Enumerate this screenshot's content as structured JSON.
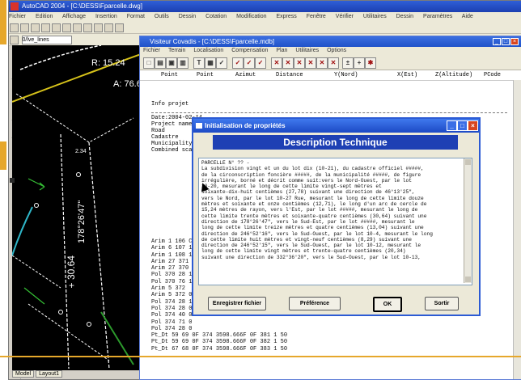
{
  "autocad": {
    "title": "AutoCAD 2004 - [C:\\DESS\\Fparcelle.dwg]",
    "menu": [
      "Fichier",
      "Edition",
      "Affichage",
      "Insertion",
      "Format",
      "Outils",
      "Dessin",
      "Cotation",
      "Modification",
      "Express",
      "Fenêtre",
      "Vérifier",
      "Utilitaires",
      "Dessin",
      "Paramètres",
      "Aide"
    ],
    "layer_field": "0/lve_lines",
    "tabs": [
      "Model",
      "Layout1"
    ],
    "drawing_labels": {
      "radius": "R: 15.24",
      "angle": "A: 76.64",
      "dim_vert": "178°26'47\"",
      "dim_30": "30.64",
      "dim_234": "2.34",
      "plus": "+"
    }
  },
  "covadis": {
    "title": "Visiteur Covadis - [C:\\DESS\\Fparcelle.mdb]",
    "menu": [
      "Fichier",
      "Terrain",
      "Localisation",
      "Compensation",
      "Plan",
      "Utilitaires",
      "Options"
    ],
    "columns": [
      "Point",
      "Point",
      "Azimut",
      "Distance",
      "Y(Nord)",
      "X(Est)",
      "Z(Altitude)",
      "PCode"
    ],
    "info_title": "Info projet",
    "info_lines": [
      "Date:2004-02-14",
      "Project name",
      "Road",
      "Cadastre",
      "Municipality",
      "Combined sca"
    ],
    "list_lines": [
      "Arim 1 106 C",
      "Arim 6 107 1",
      "Arim 1 108 1",
      "Arim 27 371 1",
      "Arim 27 370 1",
      "Pol 370 28 1",
      "Pol 370 76 1",
      "Arim 5 372",
      "Arim 5 372 0",
      "Pol 374 28 1",
      "Pol 374 28 0",
      "Pol 374 40 0",
      "Pol 374 71 0",
      "Pol 374 28 0",
      "Pt_Dt 59 69 0F 374 3598.666F 0F 381 1 50",
      "Pt_Dt 59 69 0F 374 3598.666F 0F 382 1 50",
      "Pt_Dt 67 68 0F 374 3598.666F 0F 383 1 50"
    ]
  },
  "dialog": {
    "title": "Initialisation de propriétés",
    "heading": "Description Technique",
    "text_lines": [
      "PARCELLE N° ?? -",
      "La subdivision vingt et un du lot dix (10-21), du cadastre officiel #####,",
      "de la circonscription foncière #####, de la municipalité #####, de figure",
      "irrégulière, borné et décrit comme suit:vers le Nord-Ouest, par le lot",
      "10-20, mesurant le long de cette limite vingt-sept mètres et",
      "soixante-dix-huit centièmes (27,78) suivant une direction de 46°13'25\",",
      "vers le Nord, par le lot 10-27 Rue, mesurant le long de cette limite douze",
      "mètres et soixante et onze centièmes (12,71), le long d'un arc de cercle de",
      "15,24 mètres de rayon, vers l'Est, par le lot #####, mesurant le long de",
      "cette limite trente mètres et soixante-quatre centièmes (30,64) suivant une",
      "direction de 178°26'47\", vers le Sud-Est, par le lot #####, mesurant le",
      "long de cette limite treize mètres et quatre centièmes (13,04) suivant une",
      "direction de 246°52'16\", vers le Sud-Ouest, par le lot 10-4, mesurant le long",
      "de cette limite huit mètres et vingt-neuf centièmes (8,29) suivant une",
      "direction de 246°52'15\", vers le Sud-Ouest, par le lot 10-12, mesurant le",
      "long de cette limite vingt mètres et trente-quatre centièmes (20,34)",
      "suivant une direction de 332°36'20\", vers le Sud-Ouest, par le lot 10-13,"
    ],
    "buttons": {
      "save": "Enregistrer fichier",
      "pref": "Préférence",
      "ok": "OK",
      "exit": "Sortir"
    }
  }
}
